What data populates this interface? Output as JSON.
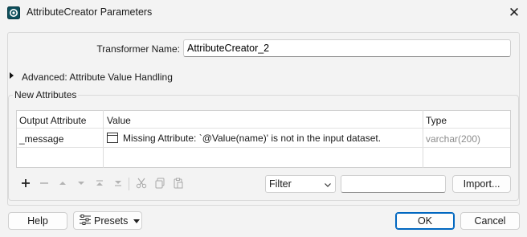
{
  "window": {
    "title": "AttributeCreator Parameters",
    "close_symbol": "✕"
  },
  "form": {
    "transformer_name_label": "Transformer Name:",
    "transformer_name_value": "AttributeCreator_2",
    "advanced_label": "Advanced: Attribute Value Handling"
  },
  "attributes": {
    "group_label": "New Attributes",
    "columns": [
      "Output Attribute",
      "Value",
      "Type"
    ],
    "rows": [
      {
        "output_attribute": "_message",
        "value": "Missing Attribute: `@Value(name)' is not in the input dataset.",
        "type": "varchar(200)"
      }
    ]
  },
  "toolbar": {
    "icons": [
      "plus-icon",
      "minus-icon",
      "move-up-icon",
      "move-down-icon",
      "move-top-icon",
      "move-bottom-icon",
      "cut-icon",
      "copy-icon",
      "paste-icon"
    ],
    "filter_selected": "Filter",
    "filter_value": "",
    "import_label": "Import..."
  },
  "footer": {
    "help_label": "Help",
    "presets_label": "Presets",
    "ok_label": "OK",
    "cancel_label": "Cancel"
  },
  "colors": {
    "accent": "#0067c0",
    "background": "#f3f3f3",
    "type_text": "#8c8c8c"
  }
}
